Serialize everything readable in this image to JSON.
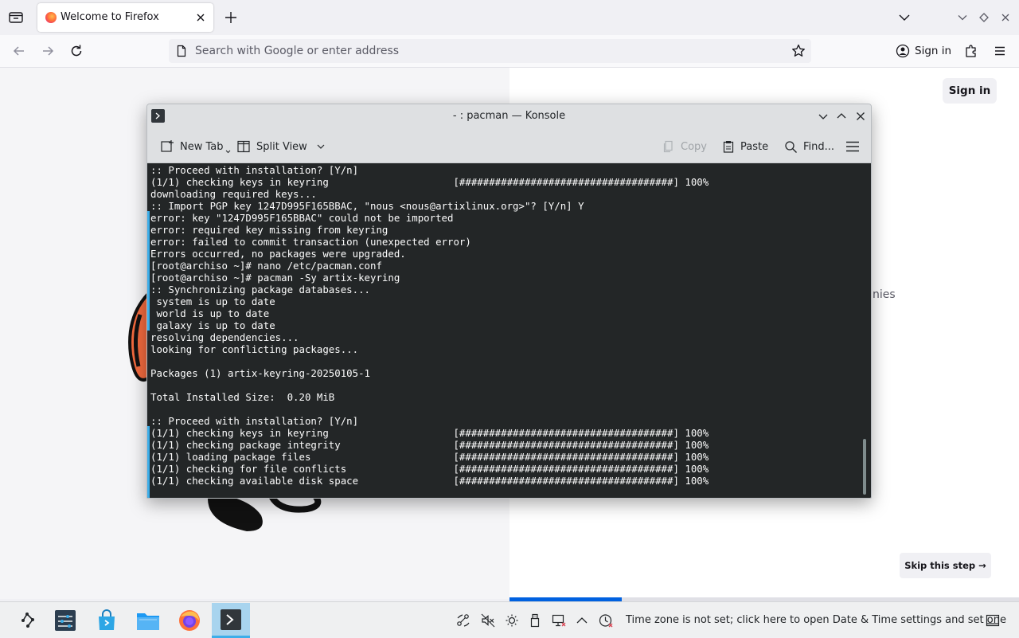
{
  "firefox": {
    "tab_title": "Welcome to Firefox",
    "url_placeholder": "Search with Google or enter address",
    "signin_label": "Sign in"
  },
  "page": {
    "signin_label": "Sign in",
    "partial_text": "nies",
    "skip_label": "Skip this step",
    "skip_arrow": "→",
    "progress_fraction": 0.22
  },
  "konsole": {
    "title": "- : pacman — Konsole",
    "toolbar": {
      "new_tab": "New Tab",
      "split_view": "Split View",
      "copy": "Copy",
      "paste": "Paste",
      "find": "Find..."
    },
    "lines": [
      ":: Proceed with installation? [Y/n]",
      "(1/1) checking keys in keyring                     [####################################] 100%",
      "downloading required keys...",
      ":: Import PGP key 1247D995F165BBAC, \"nous <nous@artixlinux.org>\"? [Y/n] Y",
      "error: key \"1247D995F165BBAC\" could not be imported",
      "error: required key missing from keyring",
      "error: failed to commit transaction (unexpected error)",
      "Errors occurred, no packages were upgraded.",
      "[root@archiso ~]# nano /etc/pacman.conf",
      "[root@archiso ~]# pacman -Sy artix-keyring",
      ":: Synchronizing package databases...",
      " system is up to date",
      " world is up to date",
      " galaxy is up to date",
      "resolving dependencies...",
      "looking for conflicting packages...",
      "",
      "Packages (1) artix-keyring-20250105-1",
      "",
      "Total Installed Size:  0.20 MiB",
      "",
      ":: Proceed with installation? [Y/n]",
      "(1/1) checking keys in keyring                     [####################################] 100%",
      "(1/1) checking package integrity                   [####################################] 100%",
      "(1/1) loading package files                        [####################################] 100%",
      "(1/1) checking for file conflicts                  [####################################] 100%",
      "(1/1) checking available disk space                [####################################] 100%"
    ]
  },
  "taskbar": {
    "timezone_notice": "Time zone is not set; click here to open Date & Time settings and set one"
  },
  "colors": {
    "accent": "#3daee9",
    "firefox_progress": "#0061e0",
    "terminal_bg": "#232627",
    "terminal_fg": "#fcfcfc"
  }
}
